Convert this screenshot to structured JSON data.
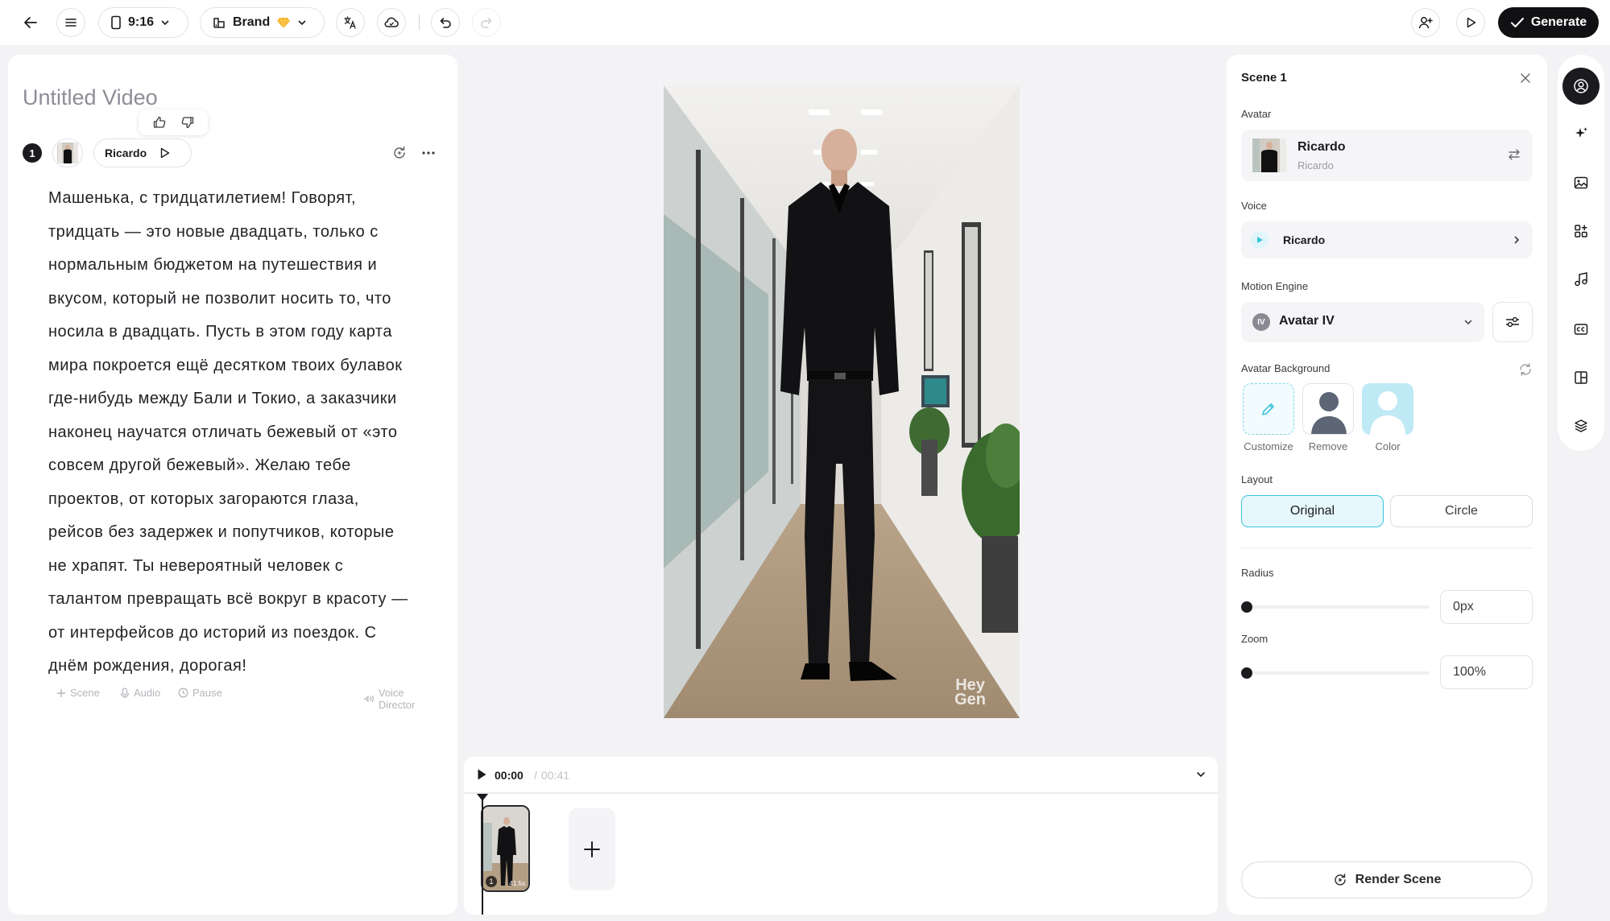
{
  "topbar": {
    "aspect_ratio": "9:16",
    "brand_label": "Brand",
    "generate_label": "Generate"
  },
  "script": {
    "title": "Untitled Video",
    "scene_number": "1",
    "voice_name": "Ricardo",
    "lines": [
      "Машенька, с тридцатилетием! Говорят,",
      "тридцать — это новые двадцать, только с",
      "нормальным бюджетом на путешествия и",
      "вкусом, который не позволит носить то, что",
      "носила в двадцать. Пусть в этом году карта",
      "мира покроется ещё десятком твоих булавок",
      "где-нибудь между Бали и Токио, а заказчики",
      "наконец научатся отличать бежевый от «это",
      "совсем другой бежевый». Желаю тебе",
      "проектов, от которых загораются глаза,",
      "рейсов без задержек и попутчиков, которые",
      "не храпят. Ты невероятный человек с",
      "талантом превращать всё вокруг в красоту —",
      "от интерфейсов до историй из поездок. С",
      "днём рождения, дорогая!"
    ],
    "actions": {
      "scene": "Scene",
      "audio": "Audio",
      "pause": "Pause",
      "voice_director": "Voice Director"
    }
  },
  "preview": {
    "watermark_line1": "Hey",
    "watermark_line2": "Gen"
  },
  "timeline": {
    "current_time": "00:00",
    "separator": "/",
    "total_time": "00:41",
    "clip_index": "1",
    "clip_duration": "41.5s"
  },
  "props": {
    "scene_title": "Scene 1",
    "avatar_label": "Avatar",
    "avatar_name": "Ricardo",
    "avatar_sub": "Ricardo",
    "voice_label": "Voice",
    "voice_name": "Ricardo",
    "engine_label": "Motion Engine",
    "engine_value": "Avatar IV",
    "engine_badge": "IV",
    "bg_label": "Avatar Background",
    "bg_options": [
      "Customize",
      "Remove",
      "Color"
    ],
    "layout_label": "Layout",
    "layout_options": [
      "Original",
      "Circle"
    ],
    "layout_selected": "Original",
    "radius_label": "Radius",
    "radius_value": "0px",
    "zoom_label": "Zoom",
    "zoom_value": "100%",
    "render_label": "Render Scene"
  },
  "colors": {
    "accent": "#3bc4dd",
    "accent_bg": "#e6f8fc",
    "primary_dark": "#111114"
  }
}
